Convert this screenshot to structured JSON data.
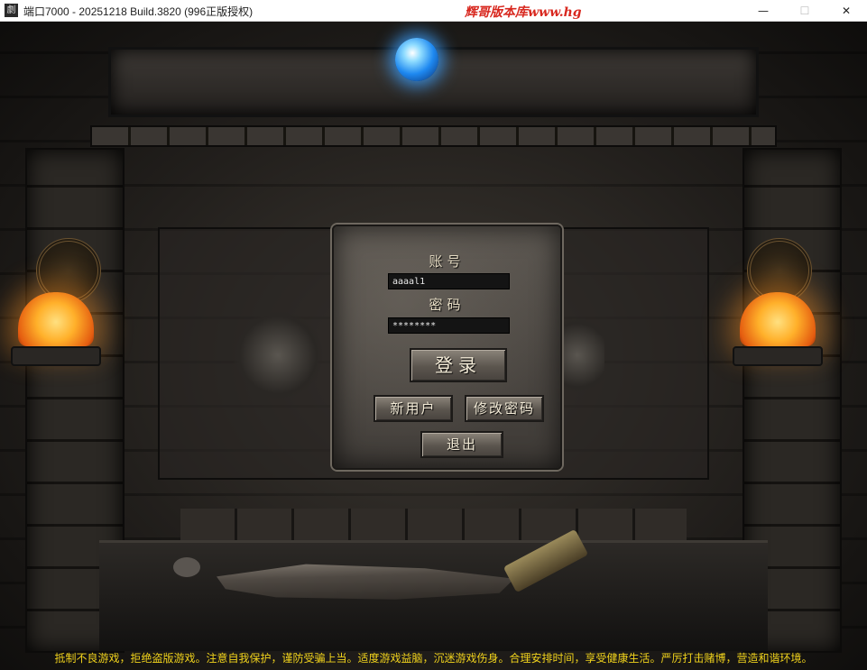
{
  "window": {
    "title": "端口7000 - 20251218 Build.3820 (996正版授权)",
    "watermark": "辉哥版本库www.hg",
    "minimize_glyph": "—",
    "maximize_glyph": "☐",
    "close_glyph": "✕",
    "app_icon_glyph": "劇"
  },
  "login": {
    "account_label": "账号",
    "account_value": "aaaal1",
    "password_label": "密码",
    "password_value": "********",
    "login_button": "登录",
    "new_user_button": "新用户",
    "change_password_button": "修改密码",
    "exit_button": "退出"
  },
  "notice": "抵制不良游戏，拒绝盗版游戏。注意自我保护，谨防受骗上当。适度游戏益脑，沉迷游戏伤身。合理安排时间，享受健康生活。严厉打击赌博，营造和谐环境。",
  "colors": {
    "notice": "#f0d21c",
    "watermark": "#d8281f",
    "gem": "#1e88f0",
    "torch": "#ffb02a"
  },
  "icons": [
    "app-icon",
    "minimize-icon",
    "maximize-icon",
    "close-icon"
  ]
}
